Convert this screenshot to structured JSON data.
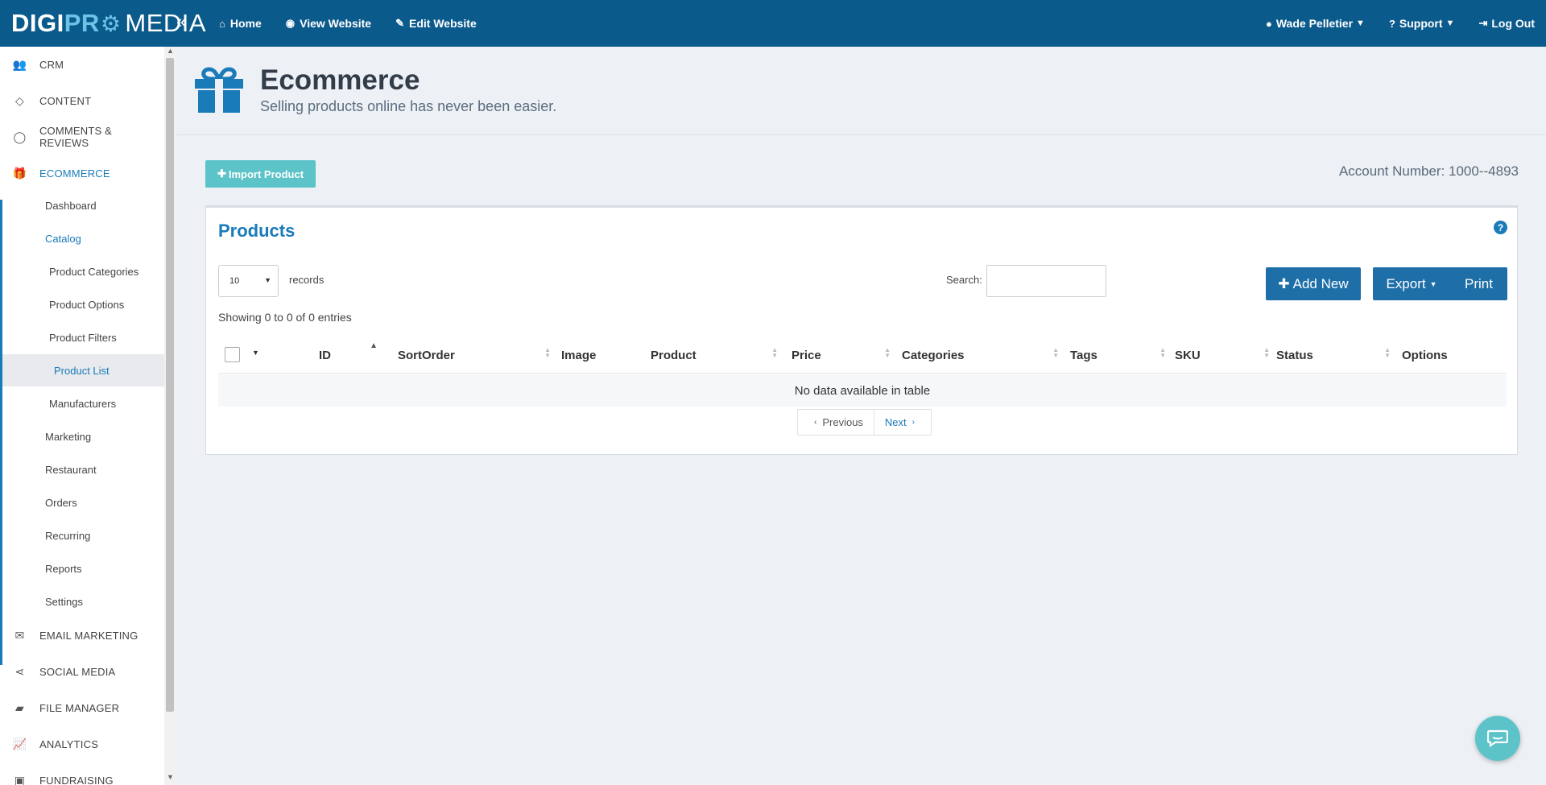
{
  "brand": {
    "part1": "DIGI",
    "part2": "PR",
    "part3": "MEDIA"
  },
  "topnav": {
    "collapse_icon": "double-chevron-left-icon",
    "items": [
      {
        "label": "Home",
        "icon": "home-icon"
      },
      {
        "label": "View Website",
        "icon": "eye-icon"
      },
      {
        "label": "Edit Website",
        "icon": "edit-icon"
      }
    ],
    "user": "Wade Pelletier",
    "support": "Support",
    "logout": "Log Out"
  },
  "sidebar": {
    "items": [
      {
        "label": "CRM",
        "icon": "users-icon"
      },
      {
        "label": "CONTENT",
        "icon": "diamond-icon"
      },
      {
        "label": "COMMENTS & REVIEWS",
        "icon": "comment-icon"
      },
      {
        "label": "ECOMMERCE",
        "icon": "gift-icon"
      },
      {
        "label": "EMAIL MARKETING",
        "icon": "envelope-icon"
      },
      {
        "label": "SOCIAL MEDIA",
        "icon": "share-icon"
      },
      {
        "label": "FILE MANAGER",
        "icon": "folder-icon"
      },
      {
        "label": "ANALYTICS",
        "icon": "line-chart-icon"
      },
      {
        "label": "FUNDRAISING",
        "icon": "money-icon"
      }
    ],
    "ecommerce_sub": [
      "Dashboard",
      "Catalog",
      "Product Categories",
      "Product Options",
      "Product Filters",
      "Product List",
      "Manufacturers",
      "Marketing",
      "Restaurant",
      "Orders",
      "Recurring",
      "Reports",
      "Settings"
    ]
  },
  "header": {
    "title": "Ecommerce",
    "subtitle": "Selling products online has never been easier."
  },
  "content": {
    "import_label": "Import Product",
    "account": "Account Number: 1000--4893"
  },
  "panel": {
    "title": "Products",
    "length_value": "10",
    "records_label": "records",
    "search_label": "Search:",
    "add_label": "Add New",
    "export_label": "Export",
    "print_label": "Print",
    "showing": "Showing 0 to 0 of 0 entries",
    "columns": [
      "ID",
      "SortOrder",
      "Image",
      "Product",
      "Price",
      "Categories",
      "Tags",
      "SKU",
      "Status",
      "Options"
    ],
    "empty": "No data available in table",
    "prev": "Previous",
    "next": "Next"
  },
  "colors": {
    "topbar": "#0b5a8c",
    "accent": "#1a7bb9",
    "teal": "#5cc3c8"
  }
}
